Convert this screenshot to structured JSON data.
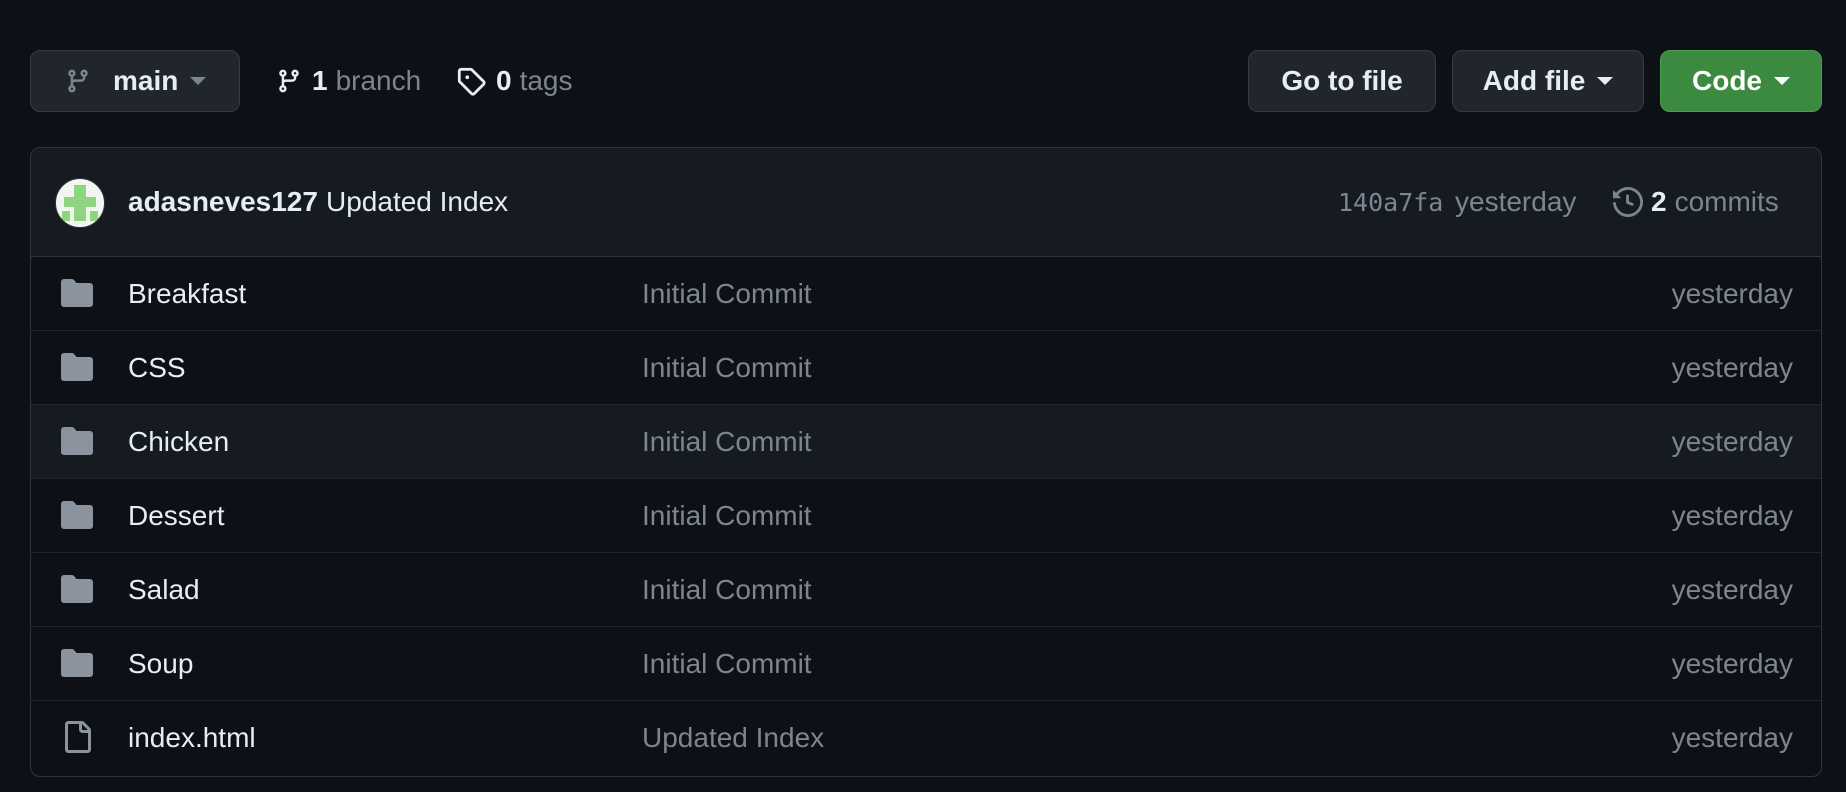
{
  "toolbar": {
    "branch_label": "main",
    "branch_count": "1",
    "branch_word": "branch",
    "tag_count": "0",
    "tag_word": "tags",
    "goto_label": "Go to file",
    "add_label": "Add file",
    "code_label": "Code",
    "code_color": "#3c8a3f"
  },
  "commit": {
    "author": "adasneves127",
    "message": "Updated Index",
    "sha": "140a7fa",
    "time": "yesterday",
    "count": "2",
    "count_word": "commits"
  },
  "files": [
    {
      "type": "folder-icon",
      "name": "Breakfast",
      "message": "Initial Commit",
      "age": "yesterday"
    },
    {
      "type": "folder-icon",
      "name": "CSS",
      "message": "Initial Commit",
      "age": "yesterday"
    },
    {
      "type": "folder-icon",
      "name": "Chicken",
      "message": "Initial Commit",
      "age": "yesterday"
    },
    {
      "type": "folder-icon",
      "name": "Dessert",
      "message": "Initial Commit",
      "age": "yesterday"
    },
    {
      "type": "folder-icon",
      "name": "Salad",
      "message": "Initial Commit",
      "age": "yesterday"
    },
    {
      "type": "folder-icon",
      "name": "Soup",
      "message": "Initial Commit",
      "age": "yesterday"
    },
    {
      "type": "file-icon",
      "name": "index.html",
      "message": "Updated Index",
      "age": "yesterday"
    }
  ]
}
